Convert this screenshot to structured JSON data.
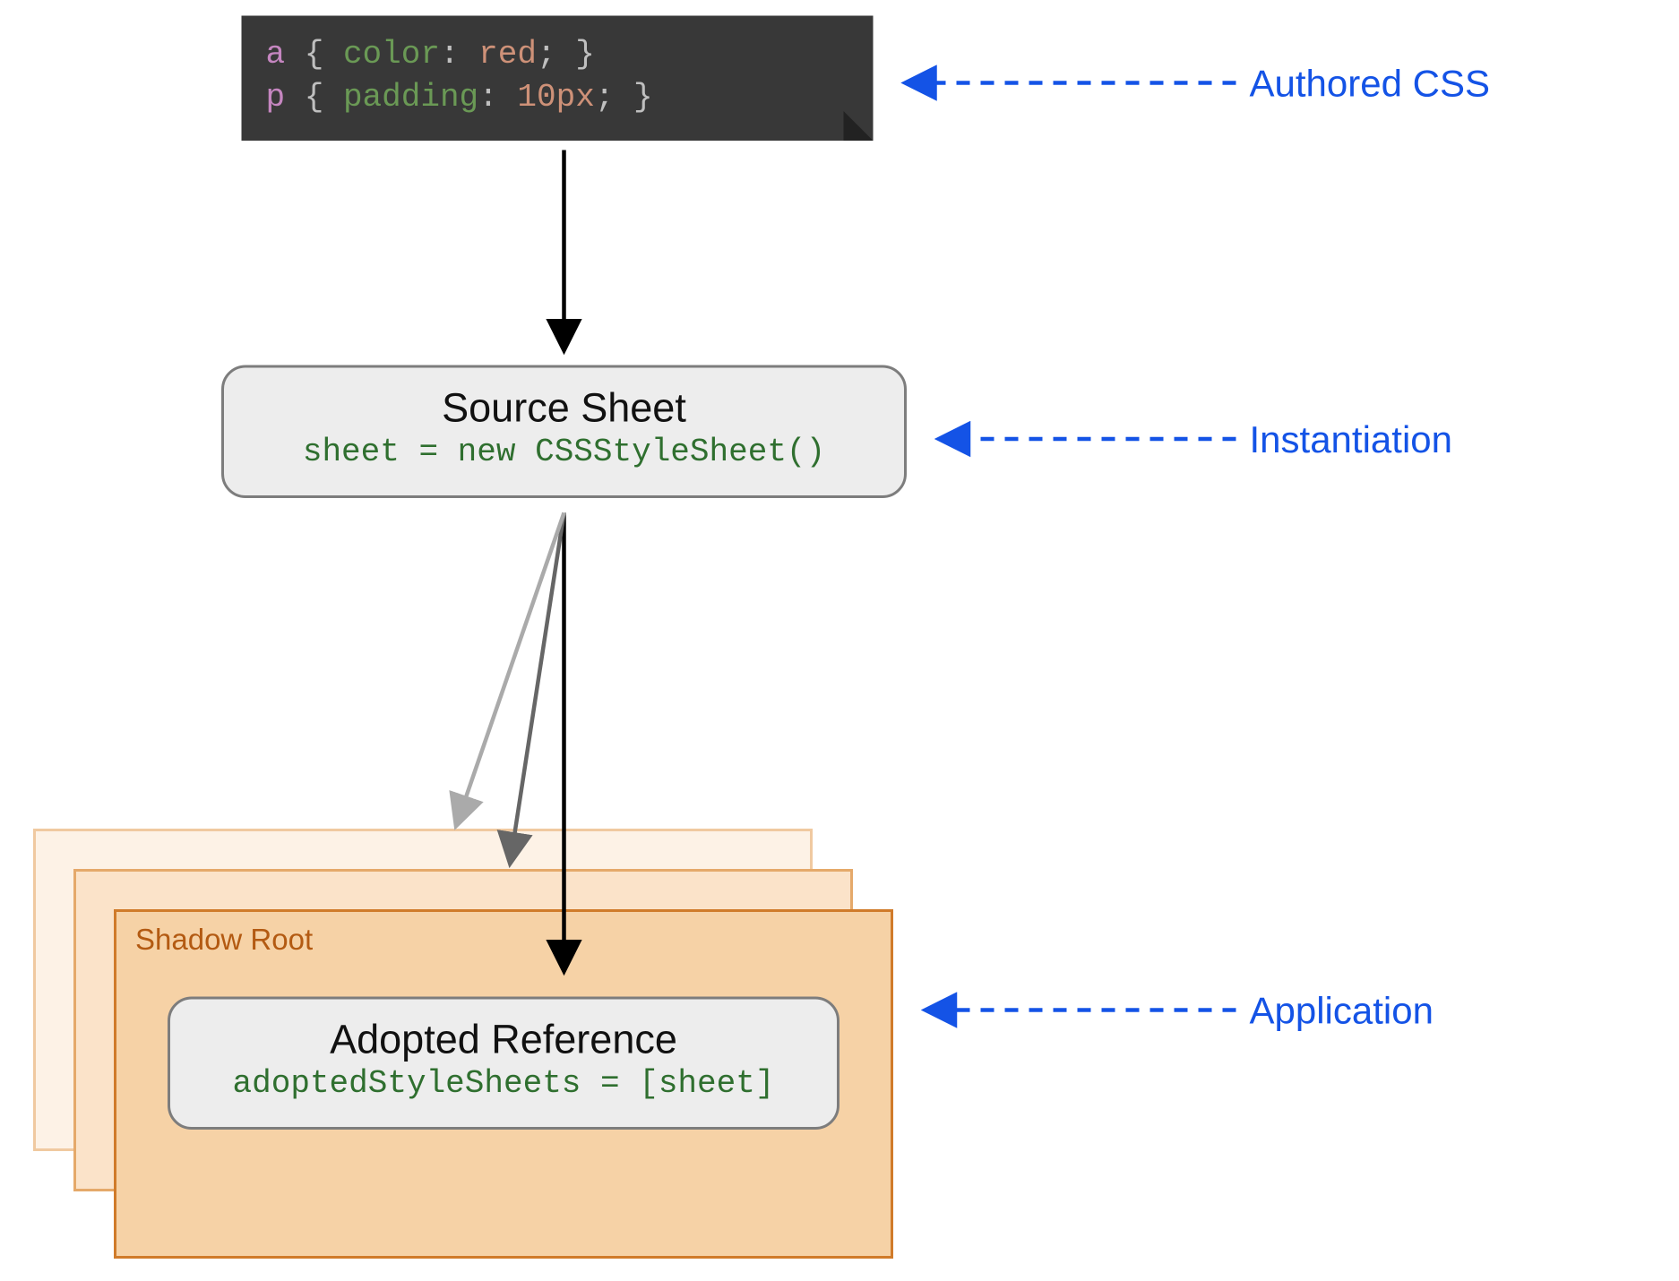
{
  "code": {
    "line1": {
      "selector": "a",
      "property": "color",
      "value": "red"
    },
    "line2": {
      "selector": "p",
      "property": "padding",
      "value": "10px"
    }
  },
  "source_box": {
    "title": "Source Sheet",
    "code": "sheet = new CSSStyleSheet()"
  },
  "shadow_root_label": "Shadow Root",
  "adopted_box": {
    "title": "Adopted Reference",
    "code": "adoptedStyleSheets = [sheet]"
  },
  "annotations": {
    "authored_css": "Authored CSS",
    "instantiation": "Instantiation",
    "application": "Application"
  }
}
